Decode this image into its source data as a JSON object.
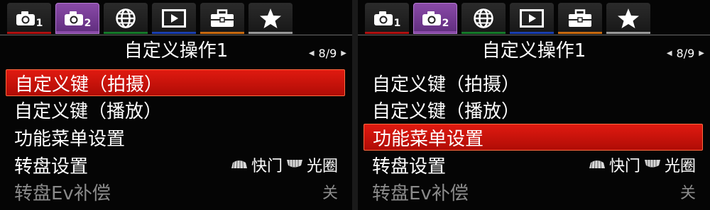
{
  "panels": [
    {
      "tabs": [
        {
          "icon": "camera-icon",
          "num": "1",
          "active": false,
          "strip": "#b01010"
        },
        {
          "icon": "camera-icon",
          "num": "2",
          "active": true,
          "strip": "#8a4aa8"
        },
        {
          "icon": "globe-icon",
          "num": "",
          "active": false,
          "strip": "#157a2a"
        },
        {
          "icon": "playback-icon",
          "num": "",
          "active": false,
          "strip": "#1a3fb0"
        },
        {
          "icon": "toolbox-icon",
          "num": "",
          "active": false,
          "strip": "#c86a10"
        },
        {
          "icon": "star-icon",
          "num": "",
          "active": false,
          "strip": "#9a9a9a"
        }
      ],
      "title": "自定义操作1",
      "page": "8/9",
      "rows": [
        {
          "label": "自定义键（拍摄）",
          "value": "",
          "selected": true,
          "dim": false
        },
        {
          "label": "自定义键（播放）",
          "value": "",
          "selected": false,
          "dim": false
        },
        {
          "label": "功能菜单设置",
          "value": "",
          "selected": false,
          "dim": false
        },
        {
          "label": "转盘设置",
          "value": "",
          "dial_a": "快门",
          "dial_b": "光圈",
          "selected": false,
          "dim": false
        },
        {
          "label": "转盘Ev补偿",
          "value": "关",
          "selected": false,
          "dim": true
        }
      ]
    },
    {
      "tabs": [
        {
          "icon": "camera-icon",
          "num": "1",
          "active": false,
          "strip": "#b01010"
        },
        {
          "icon": "camera-icon",
          "num": "2",
          "active": true,
          "strip": "#8a4aa8"
        },
        {
          "icon": "globe-icon",
          "num": "",
          "active": false,
          "strip": "#157a2a"
        },
        {
          "icon": "playback-icon",
          "num": "",
          "active": false,
          "strip": "#1a3fb0"
        },
        {
          "icon": "toolbox-icon",
          "num": "",
          "active": false,
          "strip": "#c86a10"
        },
        {
          "icon": "star-icon",
          "num": "",
          "active": false,
          "strip": "#9a9a9a"
        }
      ],
      "title": "自定义操作1",
      "page": "8/9",
      "rows": [
        {
          "label": "自定义键（拍摄）",
          "value": "",
          "selected": false,
          "dim": false
        },
        {
          "label": "自定义键（播放）",
          "value": "",
          "selected": false,
          "dim": false
        },
        {
          "label": "功能菜单设置",
          "value": "",
          "selected": true,
          "dim": false
        },
        {
          "label": "转盘设置",
          "value": "",
          "dial_a": "快门",
          "dial_b": "光圈",
          "selected": false,
          "dim": false
        },
        {
          "label": "转盘Ev补偿",
          "value": "关",
          "selected": false,
          "dim": true
        }
      ]
    }
  ]
}
